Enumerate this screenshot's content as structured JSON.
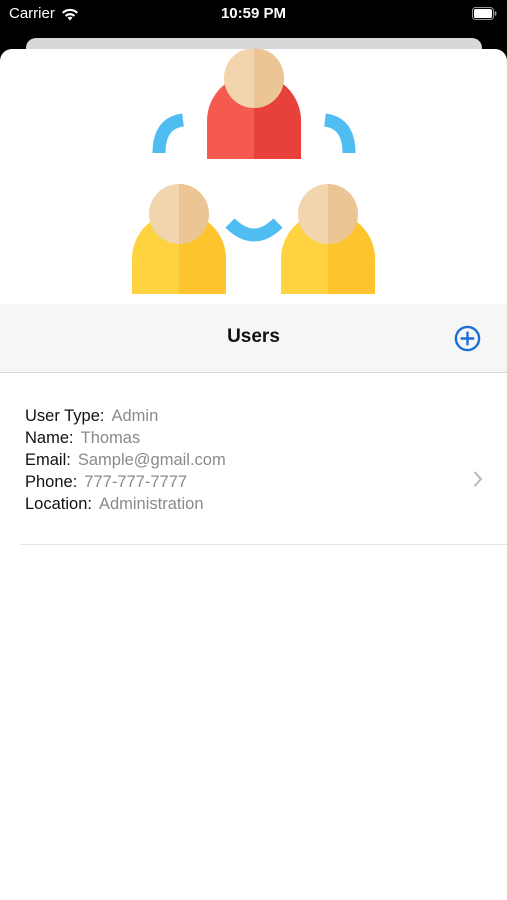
{
  "status_bar": {
    "carrier": "Carrier",
    "time": "10:59 PM"
  },
  "header": {
    "title": "Users",
    "add_icon": "plus-circle-icon",
    "hero_icon": "team-network-icon"
  },
  "colors": {
    "accent": "#1a6fd6",
    "red_person": "#f55a4e",
    "yellow_person": "#fec42d",
    "head": "#f2d4ad",
    "connector": "#4fbdf2"
  },
  "users": [
    {
      "type_label": "User Type:",
      "type": "Admin",
      "name_label": "Name:",
      "name": "Thomas",
      "email_label": "Email:",
      "email": "Sample@gmail.com",
      "phone_label": "Phone:",
      "phone": "777-777-7777",
      "location_label": "Location:",
      "location": "Administration"
    }
  ]
}
